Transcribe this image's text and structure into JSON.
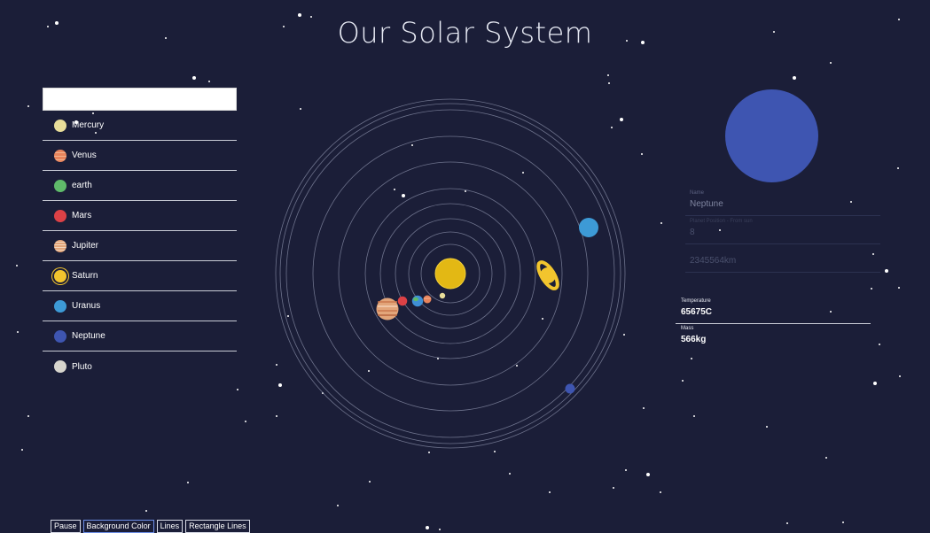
{
  "title": "Our Solar System",
  "planets": [
    {
      "label": "Mercury",
      "color": "#e8dd9a"
    },
    {
      "label": "Venus",
      "color": "#e8845c"
    },
    {
      "label": "earth",
      "color": "#5fba6a"
    },
    {
      "label": "Mars",
      "color": "#dc4146"
    },
    {
      "label": "Jupiter",
      "color": "#e2a57a"
    },
    {
      "label": "Saturn",
      "color": "#f2c52e"
    },
    {
      "label": "Uranus",
      "color": "#3d9ad6"
    },
    {
      "label": "Neptune",
      "color": "#3e55b1"
    },
    {
      "label": "Pluto",
      "color": "#d7d5cd"
    }
  ],
  "info": {
    "preview_color": "#3e55b1",
    "name_label": "Name",
    "name_value": "Neptune",
    "position_label": "Planet Position - From sun",
    "position_value": "8",
    "field3_value": "2345564km",
    "temperature_label": "Temperature",
    "temperature_value": "65675C",
    "mass_label": "Mass",
    "mass_value": "566kg"
  },
  "controls": {
    "pause": "Pause",
    "background": "Background Color",
    "lines": "Lines",
    "rect_lines": "Rectangle Lines"
  },
  "colors": {
    "background": "#1b1e38",
    "sun": "#e3b814",
    "orbit": "#8a8fa8"
  }
}
